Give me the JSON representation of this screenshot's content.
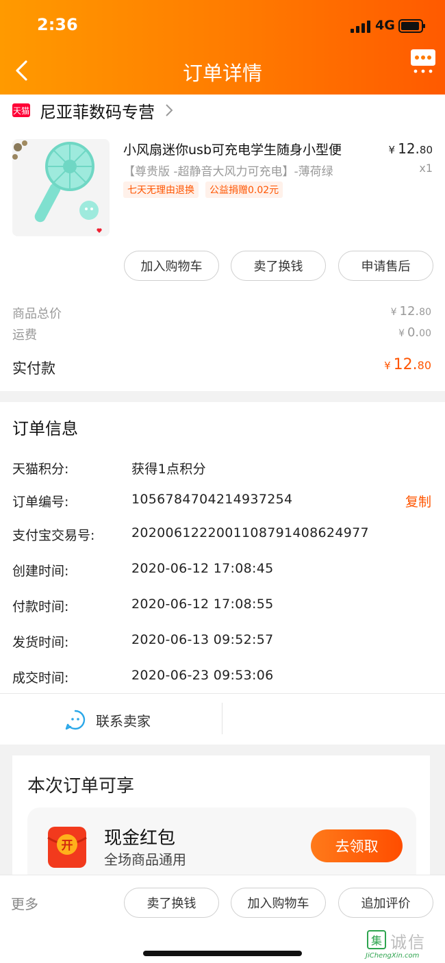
{
  "status": {
    "time": "2:36",
    "network": "4G"
  },
  "nav": {
    "title": "订单详情"
  },
  "shop": {
    "badge": "天猫",
    "name": "尼亚菲数码专营"
  },
  "product": {
    "title": "小风扇迷你usb可充电学生随身小型便",
    "spec": "【尊贵版 -超静音大风力可充电】-薄荷绿",
    "price_currency": "¥",
    "price_int": "12.",
    "price_dec": "80",
    "quantity": "x1",
    "tags": [
      "七天无理由退换",
      "公益捐赠0.02元"
    ]
  },
  "item_actions": {
    "add_cart": "加入购物车",
    "sell_swap": "卖了换钱",
    "after_sale": "申请售后"
  },
  "summary": {
    "total_label": "商品总价",
    "total_cur": "¥",
    "total_int": "12.",
    "total_dec": "80",
    "shipping_label": "运费",
    "shipping_cur": "¥",
    "shipping_int": "0.",
    "shipping_dec": "00",
    "paid_label": "实付款",
    "paid_cur": "¥",
    "paid_int": "12.",
    "paid_dec": "80"
  },
  "order_info": {
    "heading": "订单信息",
    "copy_label": "复制",
    "rows": [
      {
        "label": "天猫积分:",
        "value": "获得1点积分"
      },
      {
        "label": "订单编号:",
        "value": "1056784704214937254"
      },
      {
        "label": "支付宝交易号:",
        "value": "2020061222001108791408624977"
      },
      {
        "label": "创建时间:",
        "value": "2020-06-12 17:08:45"
      },
      {
        "label": "付款时间:",
        "value": "2020-06-12 17:08:55"
      },
      {
        "label": "发货时间:",
        "value": "2020-06-13 09:52:57"
      },
      {
        "label": "成交时间:",
        "value": "2020-06-23 09:53:06"
      }
    ]
  },
  "contact": {
    "label": "联系卖家"
  },
  "benefits": {
    "title": "本次订单可享",
    "redpack_icon_char": "开",
    "redpack_title": "现金红包",
    "redpack_subtitle": "全场商品通用",
    "redpack_button": "去领取"
  },
  "bottom": {
    "more": "更多",
    "sell_swap": "卖了换钱",
    "add_cart": "加入购物车",
    "add_review": "追加评价"
  },
  "watermark": {
    "logo_char": "集",
    "text": "诚信",
    "url": "JiChengXin.com"
  },
  "colors": {
    "accent": "#ff5500",
    "header_start": "#ff9a00",
    "header_end": "#ff5a00"
  }
}
